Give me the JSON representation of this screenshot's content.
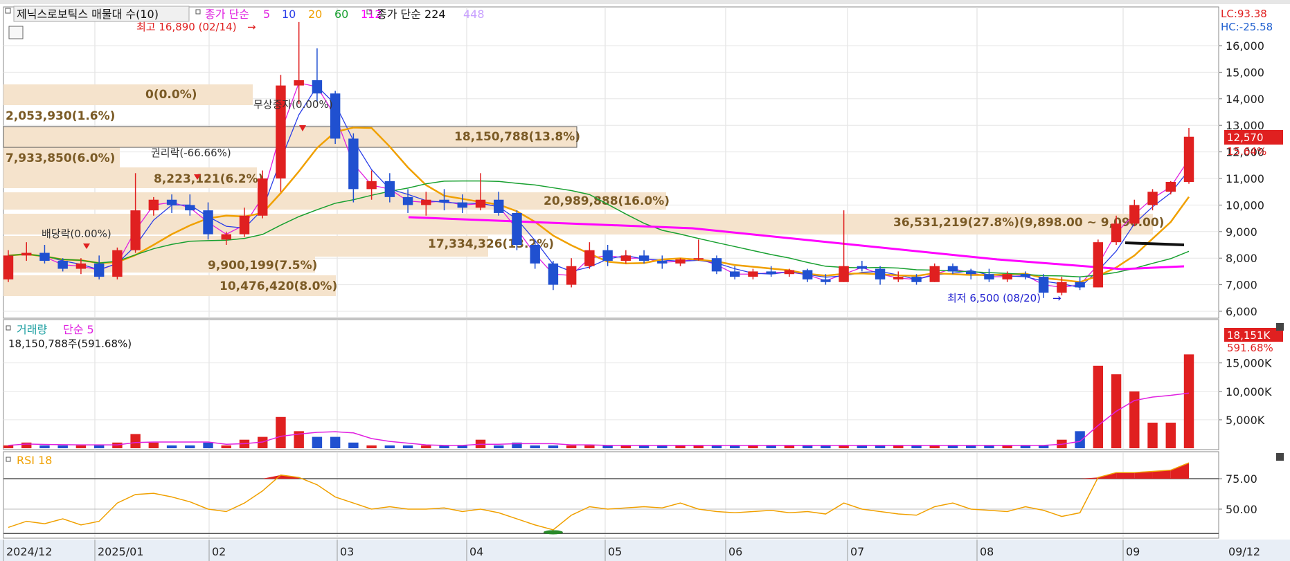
{
  "legend": {
    "stock": "제닉스로보틱스 매물대 수(10)",
    "ma_label": "종가 단순",
    "ma_periods": [
      {
        "value": "5",
        "color": "#e020e0"
      },
      {
        "value": "10",
        "color": "#2a3ee8"
      },
      {
        "value": "20",
        "color": "#f0a000"
      },
      {
        "value": "60",
        "color": "#18a030"
      },
      {
        "value": "112",
        "color": "#ff00ff"
      }
    ],
    "ma2_label": "종가 단순 224",
    "ma2_extra": {
      "value": "448",
      "color": "#c8a0ff"
    }
  },
  "scale_info": {
    "lc": "LC:93.38",
    "hc": "HC:-25.58"
  },
  "annotations": {
    "high": "최고 16,890 (02/14)",
    "low": "최저 6,500 (08/20)",
    "bonus_issue": "무상증자(0.00%)",
    "rights_ex": "권리락(-66.66%)",
    "dividend_ex": "배당락(0.00%)"
  },
  "volume_profile": [
    {
      "label": "0(0.0%)"
    },
    {
      "label": "2,053,930(1.6%)"
    },
    {
      "label": "7,933,850(6.0%)"
    },
    {
      "label": "18,150,788(13.8%)"
    },
    {
      "label": "8,223,121(6.2%)"
    },
    {
      "label": "20,989,888(16.0%)"
    },
    {
      "label": "36,531,219(27.8%)(9,898.00 ~ 9,096.00)"
    },
    {
      "label": "17,334,326(13.2%)"
    },
    {
      "label": "9,900,199(7.5%)"
    },
    {
      "label": "10,476,420(8.0%)"
    }
  ],
  "price_axis": [
    "16,000",
    "15,000",
    "14,000",
    "13,000",
    "12,000",
    "11,000",
    "10,000",
    "9,000",
    "8,000",
    "7,000",
    "6,000"
  ],
  "price_badge": {
    "price": "12,570",
    "change": "15.64%"
  },
  "volume_panel": {
    "title": "거래량",
    "ma": "단순 5",
    "info": "18,150,788주(591.68%)",
    "axis": [
      "15,000K",
      "10,000K",
      "5,000K"
    ],
    "badge_value": "18,151K",
    "badge_pct": "591.68%"
  },
  "rsi_panel": {
    "title": "RSI 18",
    "axis": [
      "75.00",
      "50.00"
    ]
  },
  "x_axis": [
    "2024/12",
    "2025/01",
    "02",
    "03",
    "04",
    "05",
    "06",
    "07",
    "08",
    "09",
    "09/12"
  ],
  "colors": {
    "up": "#e02020",
    "down": "#2050d0",
    "profile": "#f5e3cc",
    "ma5": "#e020e0",
    "ma10": "#2a3ee8",
    "ma20": "#f0a000",
    "ma60": "#18a030",
    "ma112": "#ff00ff",
    "rsi": "#f0a000"
  },
  "chart_data": {
    "type": "candlestick",
    "title": "제닉스로보틱스",
    "price_ylim": [
      6000,
      16000
    ],
    "x_range": [
      "2024-12",
      "2025-09-12"
    ],
    "ohlc": [
      {
        "date": "2024-12",
        "o": 7200,
        "h": 8300,
        "l": 7100,
        "c": 8100
      },
      {
        "date": "2024-12",
        "o": 8100,
        "h": 8600,
        "l": 7900,
        "c": 8200
      },
      {
        "date": "2024-12",
        "o": 8200,
        "h": 8500,
        "l": 7800,
        "c": 7900
      },
      {
        "date": "2024-12",
        "o": 7900,
        "h": 8000,
        "l": 7500,
        "c": 7600
      },
      {
        "date": "2024-12",
        "o": 7600,
        "h": 8000,
        "l": 7400,
        "c": 7800
      },
      {
        "date": "2024-12",
        "o": 7800,
        "h": 8100,
        "l": 7200,
        "c": 7300
      },
      {
        "date": "2025-01",
        "o": 7300,
        "h": 8400,
        "l": 7200,
        "c": 8300
      },
      {
        "date": "2025-01",
        "o": 8300,
        "h": 11200,
        "l": 8200,
        "c": 9800
      },
      {
        "date": "2025-01",
        "o": 9800,
        "h": 10300,
        "l": 9600,
        "c": 10200
      },
      {
        "date": "2025-01",
        "o": 10200,
        "h": 10400,
        "l": 9700,
        "c": 10000
      },
      {
        "date": "2025-01",
        "o": 10000,
        "h": 10400,
        "l": 9600,
        "c": 9800
      },
      {
        "date": "2025-01",
        "o": 9800,
        "h": 10100,
        "l": 8700,
        "c": 8900
      },
      {
        "date": "2025-02",
        "o": 8700,
        "h": 9000,
        "l": 8500,
        "c": 8900
      },
      {
        "date": "2025-02",
        "o": 8900,
        "h": 9900,
        "l": 8800,
        "c": 9600
      },
      {
        "date": "2025-02",
        "o": 9600,
        "h": 11300,
        "l": 9500,
        "c": 11000
      },
      {
        "date": "2025-02",
        "o": 11000,
        "h": 14900,
        "l": 10500,
        "c": 14500
      },
      {
        "date": "2025-02",
        "o": 14500,
        "h": 16890,
        "l": 13800,
        "c": 14700
      },
      {
        "date": "2025-02",
        "o": 14700,
        "h": 15900,
        "l": 13900,
        "c": 14200
      },
      {
        "date": "2025-02",
        "o": 14200,
        "h": 14300,
        "l": 12300,
        "c": 12500
      },
      {
        "date": "2025-02",
        "o": 12500,
        "h": 12700,
        "l": 10100,
        "c": 10600
      },
      {
        "date": "2025-03",
        "o": 10600,
        "h": 11300,
        "l": 10200,
        "c": 10900
      },
      {
        "date": "2025-03",
        "o": 10900,
        "h": 11200,
        "l": 10100,
        "c": 10300
      },
      {
        "date": "2025-03",
        "o": 10300,
        "h": 10600,
        "l": 9700,
        "c": 10000
      },
      {
        "date": "2025-03",
        "o": 10000,
        "h": 10500,
        "l": 9600,
        "c": 10200
      },
      {
        "date": "2025-03",
        "o": 10200,
        "h": 10600,
        "l": 9800,
        "c": 10100
      },
      {
        "date": "2025-03",
        "o": 10100,
        "h": 10400,
        "l": 9700,
        "c": 9900
      },
      {
        "date": "2025-03",
        "o": 9900,
        "h": 11200,
        "l": 9800,
        "c": 10200
      },
      {
        "date": "2025-03",
        "o": 10200,
        "h": 10500,
        "l": 9600,
        "c": 9700
      },
      {
        "date": "2025-04",
        "o": 9700,
        "h": 9800,
        "l": 8300,
        "c": 8500
      },
      {
        "date": "2025-04",
        "o": 8500,
        "h": 8700,
        "l": 7600,
        "c": 7800
      },
      {
        "date": "2025-04",
        "o": 7800,
        "h": 7900,
        "l": 6800,
        "c": 7000
      },
      {
        "date": "2025-04",
        "o": 7000,
        "h": 8000,
        "l": 6900,
        "c": 7700
      },
      {
        "date": "2025-04",
        "o": 7700,
        "h": 8600,
        "l": 7600,
        "c": 8300
      },
      {
        "date": "2025-04",
        "o": 8300,
        "h": 8500,
        "l": 7700,
        "c": 7900
      },
      {
        "date": "2025-04",
        "o": 7900,
        "h": 8300,
        "l": 7800,
        "c": 8100
      },
      {
        "date": "2025-05",
        "o": 8100,
        "h": 8300,
        "l": 7800,
        "c": 7900
      },
      {
        "date": "2025-05",
        "o": 7900,
        "h": 8100,
        "l": 7600,
        "c": 7800
      },
      {
        "date": "2025-05",
        "o": 7800,
        "h": 8000,
        "l": 7700,
        "c": 7950
      },
      {
        "date": "2025-05",
        "o": 7950,
        "h": 8700,
        "l": 7900,
        "c": 8000
      },
      {
        "date": "2025-05",
        "o": 8000,
        "h": 8100,
        "l": 7400,
        "c": 7500
      },
      {
        "date": "2025-05",
        "o": 7500,
        "h": 7700,
        "l": 7200,
        "c": 7300
      },
      {
        "date": "2025-06",
        "o": 7300,
        "h": 7600,
        "l": 7200,
        "c": 7500
      },
      {
        "date": "2025-06",
        "o": 7500,
        "h": 7700,
        "l": 7300,
        "c": 7400
      },
      {
        "date": "2025-06",
        "o": 7400,
        "h": 7600,
        "l": 7300,
        "c": 7550
      },
      {
        "date": "2025-06",
        "o": 7550,
        "h": 7600,
        "l": 7100,
        "c": 7200
      },
      {
        "date": "2025-06",
        "o": 7200,
        "h": 7400,
        "l": 7000,
        "c": 7100
      },
      {
        "date": "2025-06",
        "o": 7100,
        "h": 9800,
        "l": 7100,
        "c": 7700
      },
      {
        "date": "2025-06",
        "o": 7700,
        "h": 7900,
        "l": 7500,
        "c": 7600
      },
      {
        "date": "2025-07",
        "o": 7600,
        "h": 7700,
        "l": 7000,
        "c": 7200
      },
      {
        "date": "2025-07",
        "o": 7200,
        "h": 7500,
        "l": 7100,
        "c": 7300
      },
      {
        "date": "2025-07",
        "o": 7300,
        "h": 7400,
        "l": 7000,
        "c": 7100
      },
      {
        "date": "2025-07",
        "o": 7100,
        "h": 7800,
        "l": 7100,
        "c": 7700
      },
      {
        "date": "2025-07",
        "o": 7700,
        "h": 7800,
        "l": 7400,
        "c": 7500
      },
      {
        "date": "2025-07",
        "o": 7500,
        "h": 7600,
        "l": 7200,
        "c": 7400
      },
      {
        "date": "2025-08",
        "o": 7400,
        "h": 7600,
        "l": 7100,
        "c": 7200
      },
      {
        "date": "2025-08",
        "o": 7200,
        "h": 7500,
        "l": 7100,
        "c": 7400
      },
      {
        "date": "2025-08",
        "o": 7400,
        "h": 7500,
        "l": 7200,
        "c": 7300
      },
      {
        "date": "2025-08",
        "o": 7300,
        "h": 7400,
        "l": 6500,
        "c": 6700
      },
      {
        "date": "2025-08",
        "o": 6700,
        "h": 7300,
        "l": 6600,
        "c": 7100
      },
      {
        "date": "2025-08",
        "o": 7100,
        "h": 7300,
        "l": 6800,
        "c": 6900
      },
      {
        "date": "2025-09",
        "o": 6900,
        "h": 8700,
        "l": 6900,
        "c": 8600
      },
      {
        "date": "2025-09",
        "o": 8600,
        "h": 9600,
        "l": 8500,
        "c": 9300
      },
      {
        "date": "2025-09",
        "o": 9300,
        "h": 10200,
        "l": 9200,
        "c": 10000
      },
      {
        "date": "2025-09",
        "o": 10000,
        "h": 10600,
        "l": 9800,
        "c": 10500
      },
      {
        "date": "2025-09",
        "o": 10500,
        "h": 10900,
        "l": 10400,
        "c": 10870
      },
      {
        "date": "2025-09-12",
        "o": 10870,
        "h": 12900,
        "l": 10800,
        "c": 12570
      }
    ],
    "volume": [
      1,
      2,
      1,
      1,
      1,
      1,
      2,
      5,
      2,
      1,
      1,
      2,
      1,
      3,
      4,
      11,
      6,
      4,
      4,
      2,
      1,
      1,
      1,
      1,
      1,
      1,
      3,
      1,
      2,
      1,
      1,
      1,
      1,
      1,
      1,
      1,
      1,
      1,
      1,
      1,
      1,
      1,
      1,
      1,
      1,
      1,
      1,
      1,
      1,
      1,
      1,
      1,
      1,
      1,
      1,
      1,
      1,
      1,
      3,
      6,
      29,
      26,
      20,
      9,
      9,
      33
    ],
    "volume_unit": "K-scaled",
    "rsi": [
      35,
      40,
      38,
      42,
      37,
      40,
      55,
      62,
      63,
      60,
      56,
      50,
      48,
      55,
      65,
      78,
      76,
      70,
      60,
      55,
      50,
      52,
      50,
      50,
      51,
      48,
      50,
      47,
      42,
      37,
      33,
      45,
      52,
      50,
      51,
      52,
      51,
      55,
      50,
      48,
      47,
      48,
      49,
      47,
      48,
      46,
      55,
      50,
      48,
      46,
      45,
      52,
      55,
      50,
      49,
      48,
      52,
      49,
      44,
      47,
      76,
      80,
      80,
      81,
      82,
      88
    ],
    "rsi_ylim": [
      30,
      90
    ]
  }
}
